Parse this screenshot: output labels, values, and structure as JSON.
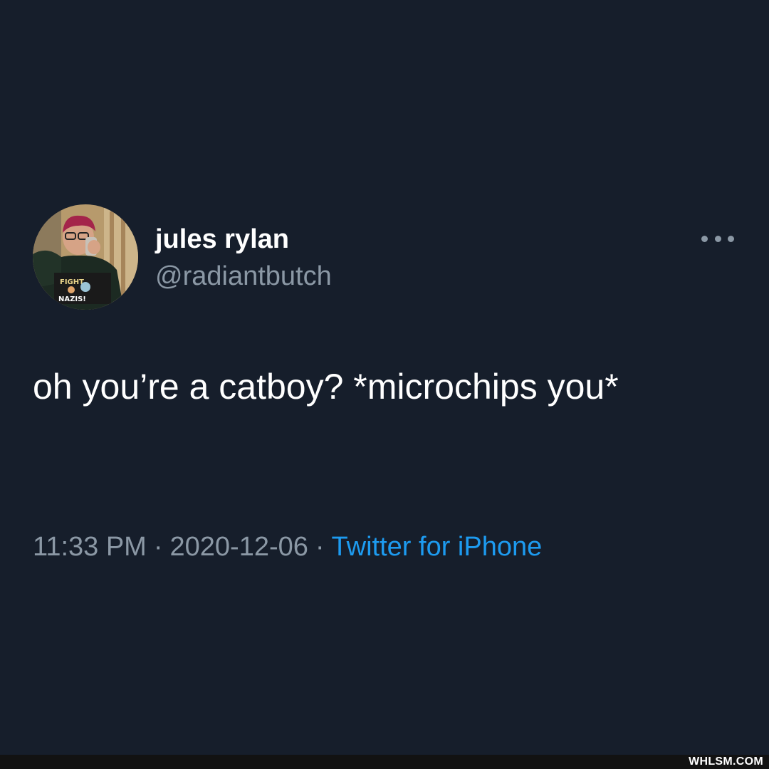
{
  "author": {
    "display_name": "jules rylan",
    "handle": "@radiantbutch",
    "avatar_shirt_text": [
      "FIGHT",
      "NAZIS!"
    ]
  },
  "menu": {
    "icon": "more-horizontal-icon"
  },
  "tweet": {
    "text": "oh you’re a catboy? *microchips you*"
  },
  "meta": {
    "time": "11:33 PM",
    "date": "2020-12-06",
    "source": "Twitter for iPhone",
    "separator": "·"
  },
  "watermark": "WHLSM.COM",
  "colors": {
    "background": "#161e2b",
    "primary_text": "#ffffff",
    "secondary_text": "#8b98a5",
    "link": "#1d9bf0"
  }
}
